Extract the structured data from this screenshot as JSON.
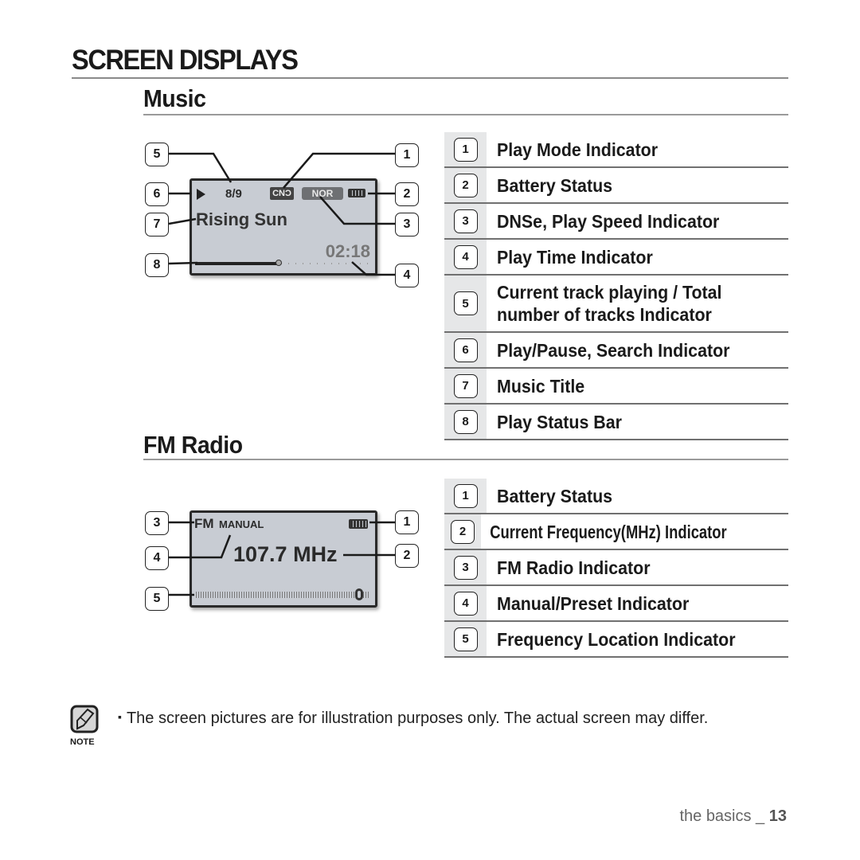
{
  "page": {
    "title": "SCREEN DISPLAYS",
    "footer_section": "the basics _ ",
    "footer_page": "13"
  },
  "music": {
    "heading": "Music",
    "screen": {
      "track_counter": "8/9",
      "play_mode_badge": "CNƆ",
      "dnse_badge": "NOR",
      "title": "Rising Sun",
      "play_time": "02:18",
      "progress_fraction": 0.48,
      "battery_level": "full"
    },
    "callouts": [
      "5",
      "1",
      "6",
      "2",
      "7",
      "3",
      "8",
      "4"
    ],
    "legend": [
      {
        "num": "1",
        "label": "Play Mode Indicator"
      },
      {
        "num": "2",
        "label": "Battery Status"
      },
      {
        "num": "3",
        "label": "DNSe, Play Speed Indicator"
      },
      {
        "num": "4",
        "label": "Play Time Indicator"
      },
      {
        "num": "5",
        "label": "Current track playing / Total",
        "label2": "number of tracks Indicator"
      },
      {
        "num": "6",
        "label": "Play/Pause, Search Indicator"
      },
      {
        "num": "7",
        "label": "Music Title"
      },
      {
        "num": "8",
        "label": "Play Status Bar"
      }
    ]
  },
  "fm": {
    "heading": "FM Radio",
    "screen": {
      "band": "FM",
      "mode": "MANUAL",
      "frequency": "107.7 MHz",
      "battery_level": "full",
      "tuner_position_fraction": 0.94
    },
    "callouts": [
      "3",
      "1",
      "4",
      "2",
      "5"
    ],
    "legend": [
      {
        "num": "1",
        "label": "Battery Status"
      },
      {
        "num": "2",
        "label": "Current Frequency(MHz) Indicator"
      },
      {
        "num": "3",
        "label": "FM Radio Indicator"
      },
      {
        "num": "4",
        "label": "Manual/Preset Indicator"
      },
      {
        "num": "5",
        "label": "Frequency Location Indicator"
      }
    ]
  },
  "note": {
    "icon": "note-pencil-icon",
    "label": "NOTE",
    "bullet": "▪",
    "text": "The screen pictures are for illustration purposes only. The actual screen may differ."
  }
}
